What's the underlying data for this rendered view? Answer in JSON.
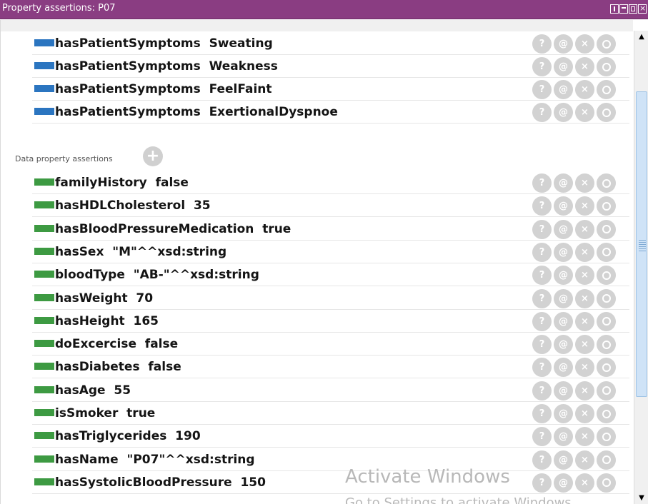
{
  "window": {
    "title": "Property assertions: P07"
  },
  "colors": {
    "title_bar": "#8a3d82",
    "object_property": "#2b75c0",
    "data_property": "#3d9a42",
    "action_button": "#d2d2d2"
  },
  "object_property_assertions": [
    {
      "text": "hasPatientSymptoms  Sweating"
    },
    {
      "text": "hasPatientSymptoms  Weakness"
    },
    {
      "text": "hasPatientSymptoms  FeelFaint"
    },
    {
      "text": "hasPatientSymptoms  ExertionalDyspnoe"
    }
  ],
  "data_section": {
    "header": "Data property assertions",
    "add_icon": "+"
  },
  "data_property_assertions": [
    {
      "text": "familyHistory  false"
    },
    {
      "text": "hasHDLCholesterol  35"
    },
    {
      "text": "hasBloodPressureMedication  true"
    },
    {
      "text": "hasSex  \"M\"^^xsd:string"
    },
    {
      "text": "bloodType  \"AB-\"^^xsd:string"
    },
    {
      "text": "hasWeight  70"
    },
    {
      "text": "hasHeight  165"
    },
    {
      "text": "doExcercise  false"
    },
    {
      "text": "hasDiabetes  false"
    },
    {
      "text": "hasAge  55"
    },
    {
      "text": "isSmoker  true"
    },
    {
      "text": "hasTriglycerides  190"
    },
    {
      "text": "hasName  \"P07\"^^xsd:string"
    },
    {
      "text": "hasSystolicBloodPressure  150"
    }
  ],
  "row_actions": [
    {
      "icon": "help-icon",
      "glyph": "?"
    },
    {
      "icon": "annotate-icon",
      "glyph": "@"
    },
    {
      "icon": "delete-icon",
      "glyph": "×"
    },
    {
      "icon": "explain-icon",
      "glyph": ""
    }
  ],
  "watermark": {
    "line1": "Activate Windows",
    "line2": "Go to Settings to activate Windows."
  },
  "scrollbar": {
    "up_glyph": "▲",
    "down_glyph": "▼"
  }
}
